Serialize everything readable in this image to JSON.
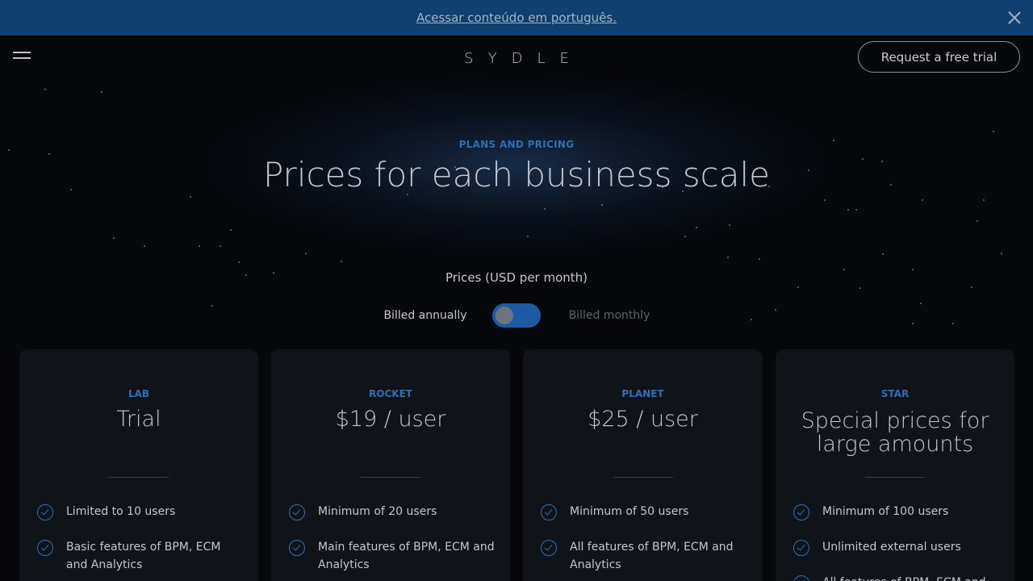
{
  "banner": {
    "link_text": "Acessar conteúdo em português."
  },
  "header": {
    "logo": "SYDLE",
    "cta": "Request a free trial"
  },
  "hero": {
    "eyebrow": "PLANS AND PRICING",
    "title": "Prices for each business scale"
  },
  "pricing": {
    "currency_label": "Prices (USD per month)",
    "billed_annually": "Billed annually",
    "billed_monthly": "Billed monthly"
  },
  "plans": [
    {
      "tier": "LAB",
      "price": "Trial",
      "features": [
        "Limited to 10 users",
        "Basic features of BPM, ECM and Analytics"
      ]
    },
    {
      "tier": "ROCKET",
      "price": "$19 / user",
      "features": [
        "Minimum of 20 users",
        "Main features of BPM, ECM and Analytics"
      ]
    },
    {
      "tier": "PLANET",
      "price": "$25 / user",
      "features": [
        "Minimum of 50 users",
        "All features of BPM, ECM and Analytics"
      ]
    },
    {
      "tier": "STAR",
      "price": "Special prices for large amounts",
      "features": [
        "Minimum of 100 users",
        "Unlimited external users",
        "All features of BPM, ECM and"
      ]
    }
  ],
  "colors": {
    "banner": "#10406f",
    "accent": "#2f6db5",
    "card": "#101419",
    "background": "#06080c"
  }
}
